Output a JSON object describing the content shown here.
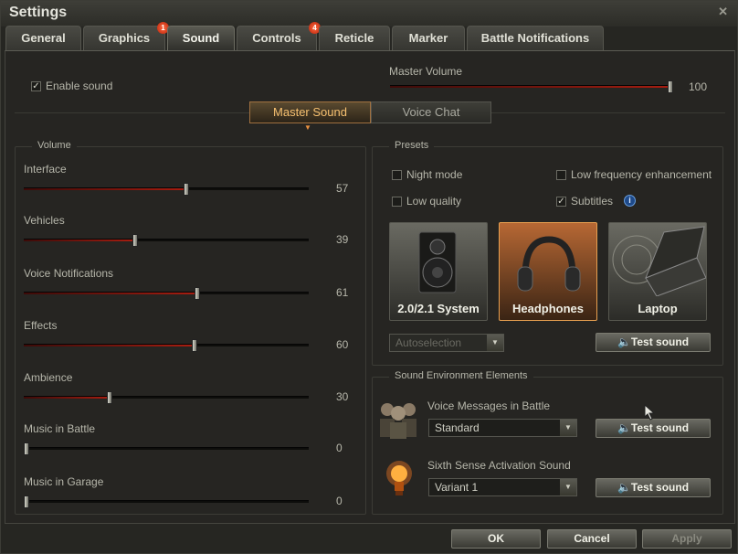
{
  "window": {
    "title": "Settings",
    "close": "✕"
  },
  "tabs": [
    {
      "label": "General"
    },
    {
      "label": "Graphics",
      "badge": "1"
    },
    {
      "label": "Sound"
    },
    {
      "label": "Controls",
      "badge": "4"
    },
    {
      "label": "Reticle"
    },
    {
      "label": "Marker"
    },
    {
      "label": "Battle Notifications"
    }
  ],
  "general": {
    "enable_sound_label": "Enable sound",
    "enable_sound_checked": true,
    "master_volume_label": "Master Volume",
    "master_volume_value": "100"
  },
  "mode_tabs": {
    "master_sound": "Master Sound",
    "voice_chat": "Voice Chat"
  },
  "volume": {
    "title": "Volume",
    "sliders": [
      {
        "label": "Interface",
        "value": "57"
      },
      {
        "label": "Vehicles",
        "value": "39"
      },
      {
        "label": "Voice Notifications",
        "value": "61"
      },
      {
        "label": "Effects",
        "value": "60"
      },
      {
        "label": "Ambience",
        "value": "30"
      },
      {
        "label": "Music in Battle",
        "value": "0"
      },
      {
        "label": "Music in Garage",
        "value": "0"
      }
    ]
  },
  "presets": {
    "title": "Presets",
    "options": {
      "night_mode": "Night mode",
      "low_frequency": "Low frequency enhancement",
      "low_quality": "Low quality",
      "subtitles": "Subtitles",
      "subtitles_checked": true
    },
    "devices": [
      {
        "label": "2.0/2.1 System"
      },
      {
        "label": "Headphones"
      },
      {
        "label": "Laptop"
      }
    ],
    "autoselection": "Autoselection",
    "test_sound": "Test sound"
  },
  "environment": {
    "title": "Sound Environment Elements",
    "voice_messages_label": "Voice Messages in Battle",
    "voice_messages_value": "Standard",
    "sixth_sense_label": "Sixth Sense Activation Sound",
    "sixth_sense_value": "Variant 1",
    "test_sound": "Test sound"
  },
  "footer": {
    "ok": "OK",
    "cancel": "Cancel",
    "apply": "Apply"
  }
}
